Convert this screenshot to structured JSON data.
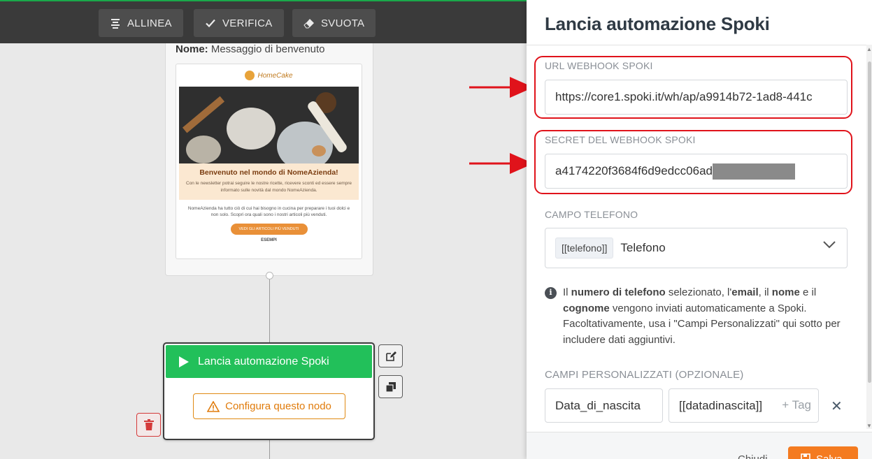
{
  "toolbar": {
    "buttons": [
      {
        "label": "ALLINEA",
        "icon": "align-icon"
      },
      {
        "label": "VERIFICA",
        "icon": "check-icon"
      },
      {
        "label": "SVUOTA",
        "icon": "eraser-icon"
      }
    ]
  },
  "canvas": {
    "email_node": {
      "name_label": "Nome:",
      "name_value": "Messaggio di benvenuto",
      "preview": {
        "brand": "HomeCake",
        "headline": "Benvenuto nel mondo di NomeAzienda!",
        "intro": "Con le newsletter potrai seguire le nostre ricette, ricevere sconti ed essere sempre informato sulle novità dal mondo NomeAzienda.",
        "body": "NomeAzienda ha tutto ciò di cui hai bisogno in cucina per preparare i tuoi dolci e non solo. Scopri ora quali sono i nostri articoli più venduti.",
        "cta": "VEDI GLI ARTICOLI PIÙ VENDUTI",
        "footer": "ESEMPI"
      }
    },
    "action_node": {
      "title": "Lancia automazione Spoki",
      "configure_label": "Configura questo nodo"
    }
  },
  "panel": {
    "title": "Lancia automazione Spoki",
    "webhook_url_label": "URL WEBHOOK SPOKI",
    "webhook_url_value": "https://core1.spoki.it/wh/ap/a9914b72-1ad8-441c",
    "secret_label": "SECRET DEL WEBHOOK SPOKI",
    "secret_value": "a4174220f3684f6d9edcc06ad",
    "phone_label": "CAMPO TELEFONO",
    "phone_tag": "[[telefono]]",
    "phone_value": "Telefono",
    "info": {
      "p1": "Il ",
      "b1": "numero di telefono",
      "p2": " selezionato, l'",
      "b2": "email",
      "p3": ", il ",
      "b3": "nome",
      "p4": " e il ",
      "b4": "cognome",
      "p5": " vengono inviati automaticamente a Spoki. Facoltativamente, usa i \"Campi Personalizzati\" qui sotto per includere dati aggiuntivi."
    },
    "custom_label": "CAMPI PERSONALIZZATI (OPZIONALE)",
    "custom_field_name": "Data_di_nascita",
    "custom_field_value": "[[datadinascita]]",
    "add_tag_label": "+ Tag",
    "close_label": "Chiudi",
    "save_label": "Salva"
  },
  "colors": {
    "toolbar_bg": "#3a3a3a",
    "node_header": "#22c05a",
    "warning": "#e07b0b",
    "highlight": "#e0131b",
    "save_button": "#f47b20"
  }
}
